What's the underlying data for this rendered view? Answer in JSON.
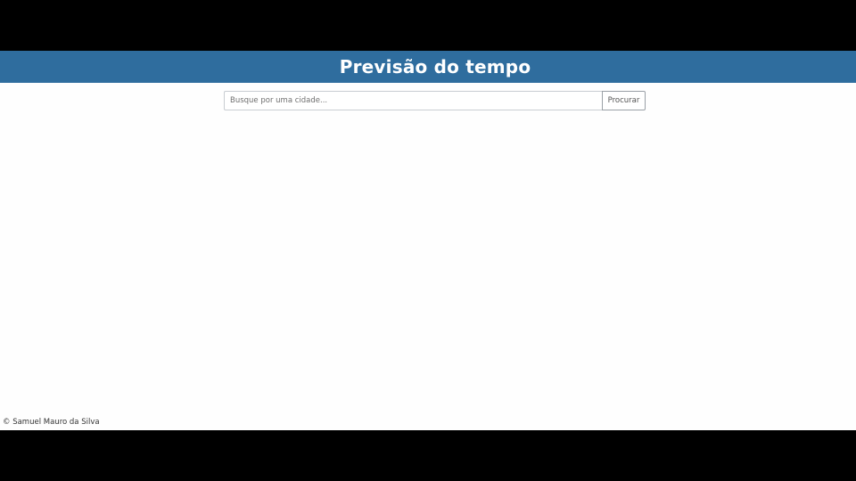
{
  "header": {
    "title": "Previsão do tempo"
  },
  "search": {
    "placeholder": "Busque por uma cidade...",
    "value": "",
    "button_label": "Procurar"
  },
  "footer": {
    "text": "© Samuel Mauro da Silva"
  },
  "colors": {
    "header_background": "#2f6d9e",
    "header_text": "#ffffff",
    "page_background": "#fefefe",
    "letterbox": "#000000"
  }
}
